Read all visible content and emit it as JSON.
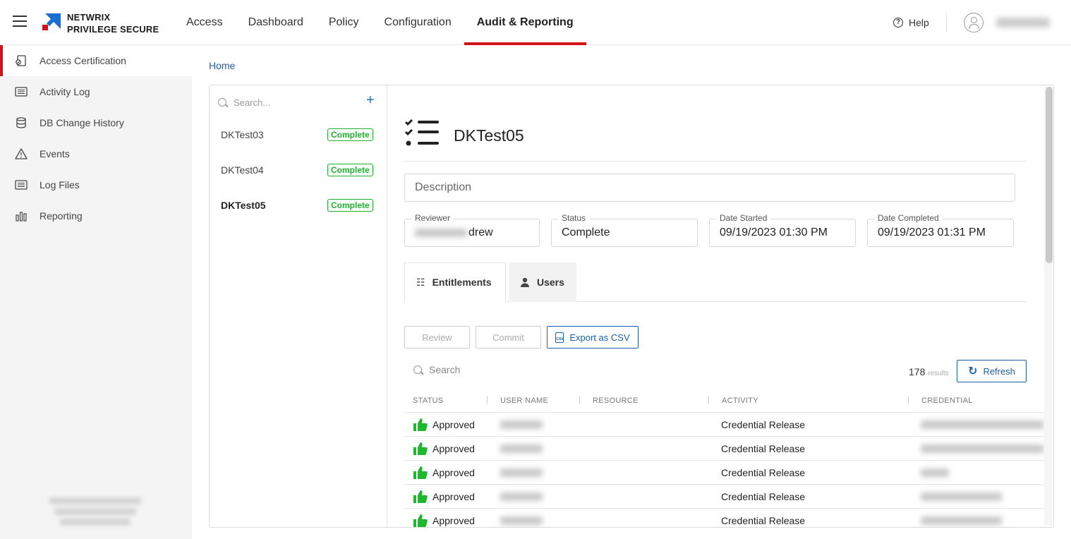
{
  "header": {
    "brand_line1": "NETWRIX",
    "brand_line2": "PRIVILEGE SECURE",
    "nav": [
      {
        "label": "Access"
      },
      {
        "label": "Dashboard"
      },
      {
        "label": "Policy"
      },
      {
        "label": "Configuration"
      },
      {
        "label": "Audit & Reporting",
        "active": true
      }
    ],
    "help_label": "Help",
    "accent_color": "#d0121b"
  },
  "sidebar": {
    "items": [
      {
        "label": "Access Certification",
        "icon": "access-certification-icon",
        "active": true
      },
      {
        "label": "Activity Log",
        "icon": "activity-log-icon"
      },
      {
        "label": "DB Change History",
        "icon": "database-icon"
      },
      {
        "label": "Events",
        "icon": "warning-icon"
      },
      {
        "label": "Log Files",
        "icon": "log-files-icon"
      },
      {
        "label": "Reporting",
        "icon": "bar-chart-icon"
      }
    ]
  },
  "breadcrumb": {
    "home": "Home"
  },
  "list": {
    "search_placeholder": "Search...",
    "add_icon": "plus-icon",
    "items": [
      {
        "name": "DKTest03",
        "status": "Complete"
      },
      {
        "name": "DKTest04",
        "status": "Complete"
      },
      {
        "name": "DKTest05",
        "status": "Complete",
        "selected": true
      }
    ],
    "status_color": "#1fb02d"
  },
  "detail": {
    "title": "DKTest05",
    "description_placeholder": "Description",
    "reviewer": {
      "label": "Reviewer",
      "value": "drew"
    },
    "status": {
      "label": "Status",
      "value": "Complete"
    },
    "date_started": {
      "label": "Date Started",
      "value": "09/19/2023 01:30 PM"
    },
    "date_completed": {
      "label": "Date Completed",
      "value": "09/19/2023 01:31 PM"
    },
    "tabs": [
      {
        "label": "Entitlements",
        "icon": "checklist-icon",
        "active": true
      },
      {
        "label": "Users",
        "icon": "user-icon"
      }
    ],
    "buttons": {
      "review": "Review",
      "commit": "Commit",
      "export": "Export as CSV"
    },
    "grid_search_placeholder": "Search",
    "results_count": "178",
    "results_label": "results",
    "refresh_label": "Refresh",
    "columns": [
      "STATUS",
      "USER NAME",
      "RESOURCE",
      "ACTIVITY",
      "CREDENTIAL"
    ],
    "rows": [
      {
        "status": "Approved",
        "activity": "Credential Release"
      },
      {
        "status": "Approved",
        "activity": "Credential Release"
      },
      {
        "status": "Approved",
        "activity": "Credential Release"
      },
      {
        "status": "Approved",
        "activity": "Credential Release"
      },
      {
        "status": "Approved",
        "activity": "Credential Release"
      }
    ],
    "approved_color": "#22b530",
    "link_color": "#1a5fa8"
  }
}
